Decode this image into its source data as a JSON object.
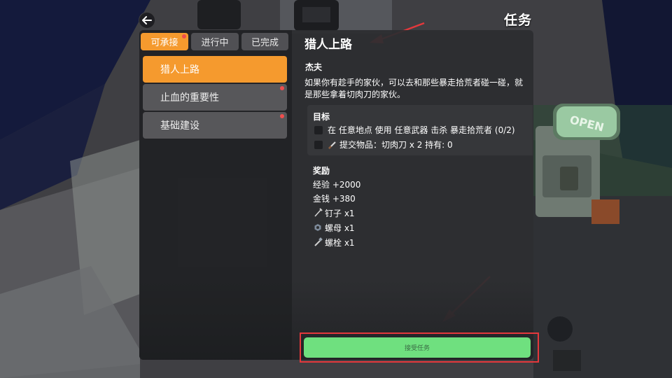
{
  "header": {
    "title": "任务",
    "back_icon": "arrow-left-icon"
  },
  "tabs": [
    {
      "label": "可承接",
      "active": true,
      "has_notification": true
    },
    {
      "label": "进行中",
      "active": false,
      "has_notification": false
    },
    {
      "label": "已完成",
      "active": false,
      "has_notification": false
    }
  ],
  "quests": [
    {
      "label": "猎人上路",
      "active": true,
      "has_notification": false
    },
    {
      "label": "止血的重要性",
      "active": false,
      "has_notification": true
    },
    {
      "label": "基础建设",
      "active": false,
      "has_notification": true
    }
  ],
  "detail": {
    "title": "猎人上路",
    "giver": "杰夫",
    "description": "如果你有趁手的家伙，可以去和那些暴走拾荒者碰一碰，就是那些拿着切肉刀的家伙。",
    "objectives_label": "目标",
    "objectives": [
      {
        "text": "在 任意地点 使用 任意武器 击杀 暴走拾荒者 (0/2)",
        "icon": ""
      },
      {
        "text": "提交物品：切肉刀 x 2 持有: 0",
        "icon": "cleaver-icon"
      }
    ],
    "rewards_label": "奖励",
    "rewards": [
      {
        "text": "经验 +2000",
        "icon": ""
      },
      {
        "text": "金钱 +380",
        "icon": ""
      },
      {
        "text": "钉子 x1",
        "icon": "nail-icon"
      },
      {
        "text": "螺母 x1",
        "icon": "nut-icon"
      },
      {
        "text": "螺栓 x1",
        "icon": "bolt-icon"
      }
    ]
  },
  "accept_button": {
    "label": "接受任务"
  },
  "colors": {
    "accent": "#f59a2e",
    "accept": "#6fe07f",
    "notification": "#ef4d4d",
    "highlight": "#e4383c"
  }
}
